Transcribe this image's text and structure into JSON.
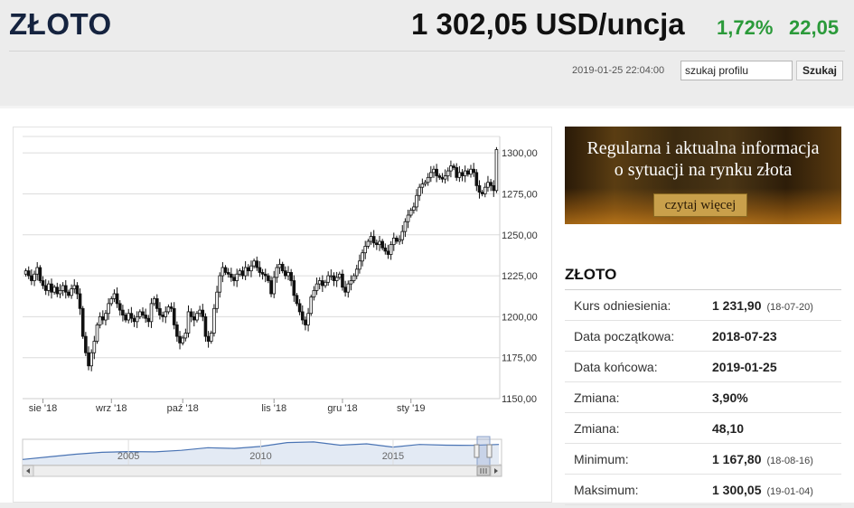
{
  "header": {
    "title": "ZŁOTO",
    "price": "1 302,05 USD/uncja",
    "change_pct": "1,72%",
    "change_abs": "22,05",
    "timestamp": "2019-01-25 22:04:00",
    "search_placeholder": "szukaj profilu",
    "search_button": "Szukaj"
  },
  "ad": {
    "line1": "Regularna i aktualna informacja",
    "line2": "o sytuacji na rynku złota",
    "button": "czytaj więcej"
  },
  "info": {
    "title": "ZŁOTO",
    "rows": [
      {
        "label": "Kurs odniesienia:",
        "value": "1 231,90",
        "date": "(18-07-20)"
      },
      {
        "label": "Data początkowa:",
        "value": "2018-07-23",
        "date": ""
      },
      {
        "label": "Data końcowa:",
        "value": "2019-01-25",
        "date": ""
      },
      {
        "label": "Zmiana:",
        "value": "3,90%",
        "date": ""
      },
      {
        "label": "Zmiana:",
        "value": "48,10",
        "date": ""
      },
      {
        "label": "Minimum:",
        "value": "1 167,80",
        "date": "(18-08-16)"
      },
      {
        "label": "Maksimum:",
        "value": "1 300,05",
        "date": "(19-01-04)"
      }
    ]
  },
  "chart_data": {
    "type": "candlestick",
    "ylim": [
      1150,
      1310
    ],
    "y_ticks": [
      "1300,00",
      "1275,00",
      "1250,00",
      "1225,00",
      "1200,00",
      "1175,00",
      "1150,00"
    ],
    "y_tick_values": [
      1300,
      1275,
      1250,
      1225,
      1200,
      1175,
      1150
    ],
    "x_ticks": [
      "sie '18",
      "wrz '18",
      "paź '18",
      "lis '18",
      "gru '18",
      "sty '19"
    ],
    "x_tick_index": [
      6,
      30,
      55,
      87,
      111,
      135
    ],
    "closes": [
      1228,
      1225,
      1222,
      1226,
      1230,
      1222,
      1219,
      1216,
      1220,
      1215,
      1218,
      1214,
      1216,
      1219,
      1215,
      1213,
      1217,
      1219,
      1214,
      1205,
      1188,
      1178,
      1170,
      1178,
      1185,
      1195,
      1200,
      1198,
      1202,
      1208,
      1211,
      1214,
      1208,
      1204,
      1201,
      1198,
      1202,
      1199,
      1197,
      1200,
      1203,
      1201,
      1199,
      1197,
      1208,
      1211,
      1205,
      1201,
      1200,
      1203,
      1206,
      1205,
      1195,
      1188,
      1184,
      1187,
      1190,
      1203,
      1200,
      1198,
      1202,
      1204,
      1200,
      1188,
      1185,
      1190,
      1205,
      1215,
      1225,
      1230,
      1227,
      1226,
      1224,
      1222,
      1226,
      1228,
      1225,
      1230,
      1228,
      1231,
      1234,
      1230,
      1227,
      1226,
      1225,
      1222,
      1214,
      1224,
      1230,
      1232,
      1228,
      1225,
      1227,
      1222,
      1213,
      1208,
      1203,
      1198,
      1195,
      1202,
      1212,
      1216,
      1220,
      1222,
      1219,
      1221,
      1225,
      1225,
      1222,
      1224,
      1226,
      1218,
      1215,
      1220,
      1222,
      1225,
      1229,
      1234,
      1239,
      1243,
      1246,
      1249,
      1245,
      1244,
      1246,
      1242,
      1240,
      1238,
      1244,
      1248,
      1246,
      1247,
      1252,
      1258,
      1262,
      1265,
      1267,
      1274,
      1279,
      1281,
      1282,
      1285,
      1288,
      1290,
      1286,
      1285,
      1284,
      1286,
      1289,
      1292,
      1291,
      1285,
      1288,
      1286,
      1289,
      1287,
      1290,
      1288,
      1280,
      1276,
      1275,
      1279,
      1282,
      1280,
      1277,
      1302
    ],
    "navigator": {
      "labels": [
        "2005",
        "2010",
        "2015"
      ],
      "label_years": [
        2005,
        2010,
        2015
      ],
      "start_year": 2001,
      "end_year": 2019.1,
      "series": [
        [
          2001,
          1210
        ],
        [
          2002,
          1230
        ],
        [
          2003,
          1250
        ],
        [
          2004,
          1265
        ],
        [
          2005,
          1270
        ],
        [
          2006,
          1268
        ],
        [
          2007,
          1280
        ],
        [
          2008,
          1300
        ],
        [
          2009,
          1295
        ],
        [
          2010,
          1310
        ],
        [
          2011,
          1340
        ],
        [
          2012,
          1345
        ],
        [
          2013,
          1320
        ],
        [
          2014,
          1330
        ],
        [
          2015,
          1305
        ],
        [
          2016,
          1325
        ],
        [
          2017,
          1320
        ],
        [
          2018,
          1318
        ],
        [
          2019,
          1325
        ]
      ]
    }
  }
}
